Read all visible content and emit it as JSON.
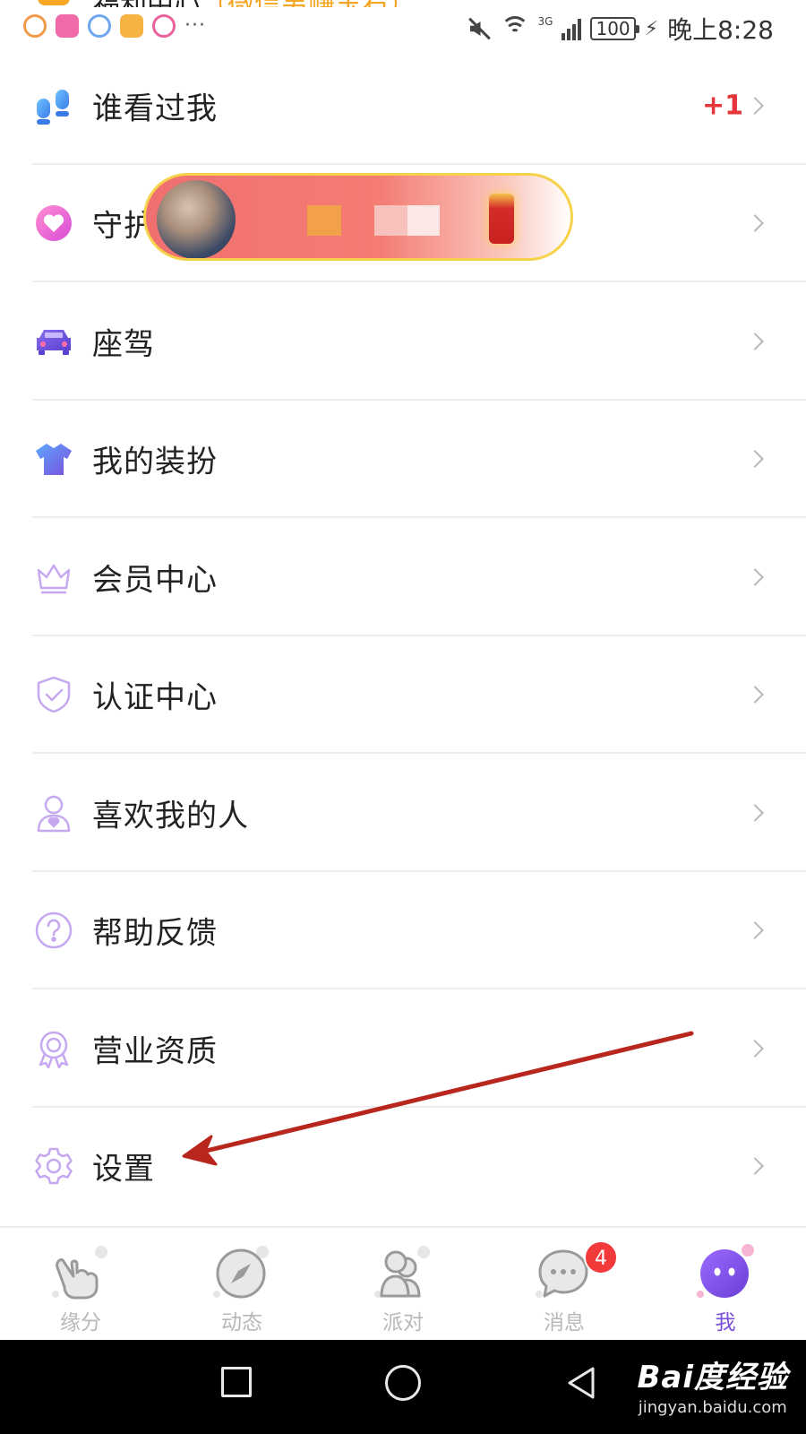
{
  "status_bar": {
    "cut_title": "福利中心",
    "cut_title_paren": "（微信另赚玉石）",
    "more": "···",
    "network": "3G",
    "battery": "100",
    "time": "晚上8:28"
  },
  "menu": {
    "items": [
      {
        "label": "谁看过我",
        "badge": "+1",
        "icon": "footprints-icon"
      },
      {
        "label": "守护",
        "icon": "heart-icon"
      },
      {
        "label": "座驾",
        "icon": "car-icon"
      },
      {
        "label": "我的装扮",
        "icon": "tshirt-icon"
      },
      {
        "label": "会员中心",
        "icon": "crown-icon"
      },
      {
        "label": "认证中心",
        "icon": "shield-check-icon"
      },
      {
        "label": "喜欢我的人",
        "icon": "person-heart-icon"
      },
      {
        "label": "帮助反馈",
        "icon": "question-icon"
      },
      {
        "label": "营业资质",
        "icon": "award-icon"
      },
      {
        "label": "设置",
        "icon": "gear-icon"
      }
    ]
  },
  "tabbar": {
    "tabs": [
      {
        "label": "缘分",
        "icon": "hand-icon"
      },
      {
        "label": "动态",
        "icon": "compass-icon"
      },
      {
        "label": "派对",
        "icon": "people-icon"
      },
      {
        "label": "消息",
        "icon": "chat-icon",
        "badge": "4"
      },
      {
        "label": "我",
        "icon": "profile-icon",
        "active": true
      }
    ]
  },
  "watermark": {
    "main": "Bai度经验",
    "sub": "jingyan.baidu.com"
  },
  "colors": {
    "accent": "#7a4ddb",
    "badge_red": "#e5353a",
    "icon_purple": "#c6a8f0"
  }
}
